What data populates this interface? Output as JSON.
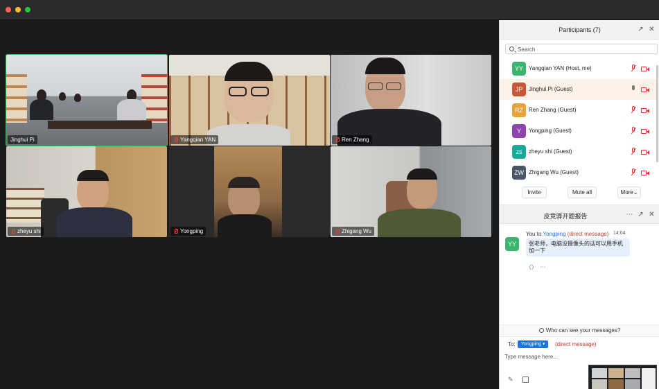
{
  "video": {
    "tiles": [
      {
        "name": "Jinghui Pi",
        "muted": false,
        "active": true
      },
      {
        "name": "Yangqian YAN",
        "muted": true,
        "active": false
      },
      {
        "name": "Ren Zhang",
        "muted": true,
        "active": false
      },
      {
        "name": "zheyu shi",
        "muted": true,
        "active": false
      },
      {
        "name": "Yongping",
        "muted": true,
        "active": false
      },
      {
        "name": "Zhigang Wu",
        "muted": true,
        "active": false
      }
    ]
  },
  "participants": {
    "title": "Participants (7)",
    "search_placeholder": "Search",
    "list": [
      {
        "initials": "YY",
        "name": "Yangqian YAN (Host, me)",
        "color": "#3cb46e",
        "mic": "muted",
        "highlight": false
      },
      {
        "initials": "JP",
        "name": "Jinghui Pi (Guest)",
        "color": "#c8573a",
        "mic": "on",
        "highlight": true
      },
      {
        "initials": "RZ",
        "name": "Ren Zhang (Guest)",
        "color": "#e8a33a",
        "mic": "muted",
        "highlight": false
      },
      {
        "initials": "Y",
        "name": "Yongping (Guest)",
        "color": "#8e44ad",
        "mic": "muted",
        "highlight": false
      },
      {
        "initials": "zs",
        "name": "zheyu shi (Guest)",
        "color": "#1aa89a",
        "mic": "muted",
        "highlight": false
      },
      {
        "initials": "ZW",
        "name": "Zhigang Wu (Guest)",
        "color": "#4a5568",
        "mic": "muted",
        "highlight": false
      }
    ],
    "buttons": {
      "invite": "Invite",
      "mute_all": "Mute all",
      "more": "More"
    }
  },
  "chat": {
    "title": "皮竞骅开题报告",
    "message": {
      "avatar": "YY",
      "prefix": "You to ",
      "recipient": "Yongping",
      "dm_tag": "(direct message)",
      "time": "14:04",
      "text": "张老师，电脑没摄像头的话可以用手机加一下"
    },
    "who_can_see": "Who can see your messages?",
    "to_label": "To:",
    "to_recipient": "Yongping",
    "to_dm_tag": "(direct message)",
    "input_placeholder": "Type message here..."
  }
}
